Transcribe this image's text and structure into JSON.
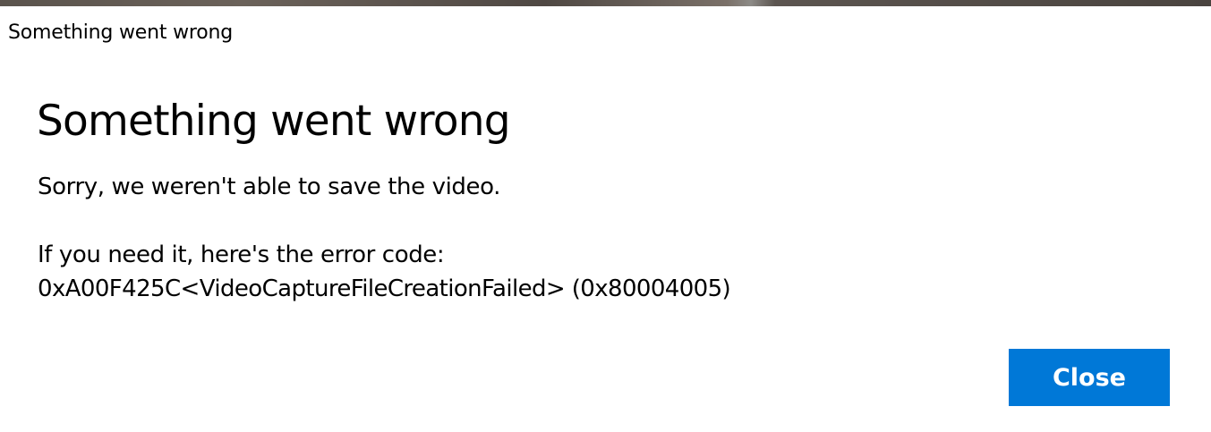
{
  "window": {
    "title": "Something went wrong"
  },
  "dialog": {
    "heading": "Something went wrong",
    "message": "Sorry, we weren't able to save the video.",
    "error_intro": "If you need it, here's the error code:",
    "error_code": "0xA00F425C<VideoCaptureFileCreationFailed> (0x80004005)",
    "close_label": "Close"
  },
  "colors": {
    "accent": "#0078d7",
    "background": "#ffffff",
    "text": "#000000"
  }
}
